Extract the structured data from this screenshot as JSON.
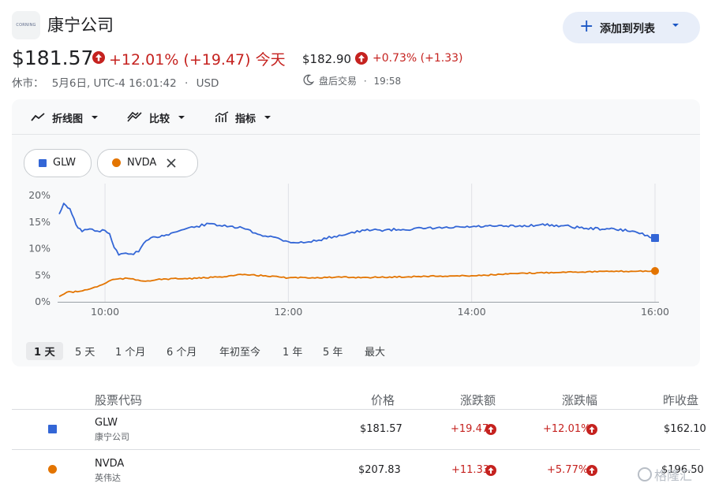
{
  "header": {
    "logo_text": "CORNING",
    "company_name": "康宁公司",
    "watchlist_button": "添加到列表"
  },
  "quote": {
    "price": "$181.57",
    "change": "+12.01% (+19.47) 今天",
    "status": "休市：",
    "date_time": "5月6日, UTC-4 16:01:42",
    "separator": "·",
    "currency": "USD",
    "after_hours_price": "$182.90",
    "after_hours_change": "+0.73% (+1.33)",
    "after_hours_label": "盘后交易",
    "after_hours_time": "19:58"
  },
  "toolbar": {
    "chart_type": "折线图",
    "compare": "比较",
    "indicators": "指标"
  },
  "compare_chips": [
    {
      "symbol": "GLW",
      "color": "#3366d6"
    },
    {
      "symbol": "NVDA",
      "color": "#e37400"
    }
  ],
  "time_ranges": [
    "1 天",
    "5 天",
    "1 个月",
    "6 个月",
    "年初至今",
    "1 年",
    "5 年",
    "最大"
  ],
  "active_range": "1 天",
  "chart_data": {
    "type": "line",
    "xlabel": "",
    "ylabel": "",
    "x_ticks": [
      "10:00",
      "12:00",
      "14:00",
      "16:00"
    ],
    "y_ticks": [
      "20%",
      "15%",
      "10%",
      "5%",
      "0%"
    ],
    "ylim": [
      0,
      20
    ],
    "xlim": [
      "9:30",
      "16:00"
    ],
    "grid": "vertical",
    "series": [
      {
        "name": "GLW",
        "color": "#3366d6",
        "x": [
          "9:30",
          "9:33",
          "9:37",
          "9:41",
          "9:45",
          "9:50",
          "9:55",
          "10:00",
          "10:03",
          "10:06",
          "10:09",
          "10:12",
          "10:17",
          "10:22",
          "10:27",
          "10:33",
          "10:40",
          "10:50",
          "11:00",
          "11:10",
          "11:20",
          "11:30",
          "11:40",
          "11:50",
          "12:00",
          "12:10",
          "12:20",
          "12:30",
          "12:40",
          "12:50",
          "13:00",
          "13:15",
          "13:30",
          "13:45",
          "14:00",
          "14:15",
          "14:30",
          "14:45",
          "15:00",
          "15:15",
          "15:30",
          "15:45",
          "15:55",
          "16:00"
        ],
        "values": [
          16.5,
          18.5,
          17.5,
          14.5,
          13.2,
          13.7,
          13.3,
          13.4,
          12.8,
          10.2,
          8.8,
          9.1,
          9.0,
          9.4,
          11.5,
          12.2,
          12.6,
          13.5,
          14.2,
          14.7,
          14.1,
          13.9,
          12.7,
          12.2,
          11.3,
          11.1,
          11.6,
          12.3,
          12.9,
          13.4,
          13.5,
          13.6,
          13.8,
          13.9,
          14.1,
          14.2,
          14.2,
          14.5,
          14.3,
          13.8,
          13.7,
          13.3,
          12.5,
          12.0
        ]
      },
      {
        "name": "NVDA",
        "color": "#e37400",
        "x": [
          "9:30",
          "9:35",
          "9:42",
          "9:50",
          "9:58",
          "10:05",
          "10:15",
          "10:25",
          "10:40",
          "11:00",
          "11:15",
          "11:30",
          "11:45",
          "12:00",
          "12:30",
          "13:00",
          "13:30",
          "14:00",
          "14:30",
          "15:00",
          "15:30",
          "16:00"
        ],
        "values": [
          1.0,
          1.8,
          1.9,
          2.4,
          3.2,
          4.2,
          4.4,
          3.9,
          4.3,
          4.4,
          4.7,
          5.1,
          4.9,
          4.5,
          4.6,
          4.6,
          4.8,
          4.9,
          5.3,
          5.6,
          5.7,
          5.8
        ]
      }
    ]
  },
  "table": {
    "headers": [
      "股票代码",
      "价格",
      "涨跌额",
      "涨跌幅",
      "昨收盘"
    ],
    "rows": [
      {
        "symbol": "GLW",
        "name": "康宁公司",
        "price": "$181.57",
        "change": "+19.47",
        "change_pct": "+12.01%",
        "prev_close": "$162.10",
        "color": "#3366d6"
      },
      {
        "symbol": "NVDA",
        "name": "英伟达",
        "price": "$207.83",
        "change": "+11.33",
        "change_pct": "+5.77%",
        "prev_close": "$196.50",
        "color": "#e37400"
      }
    ]
  },
  "watermark": "格隆汇"
}
